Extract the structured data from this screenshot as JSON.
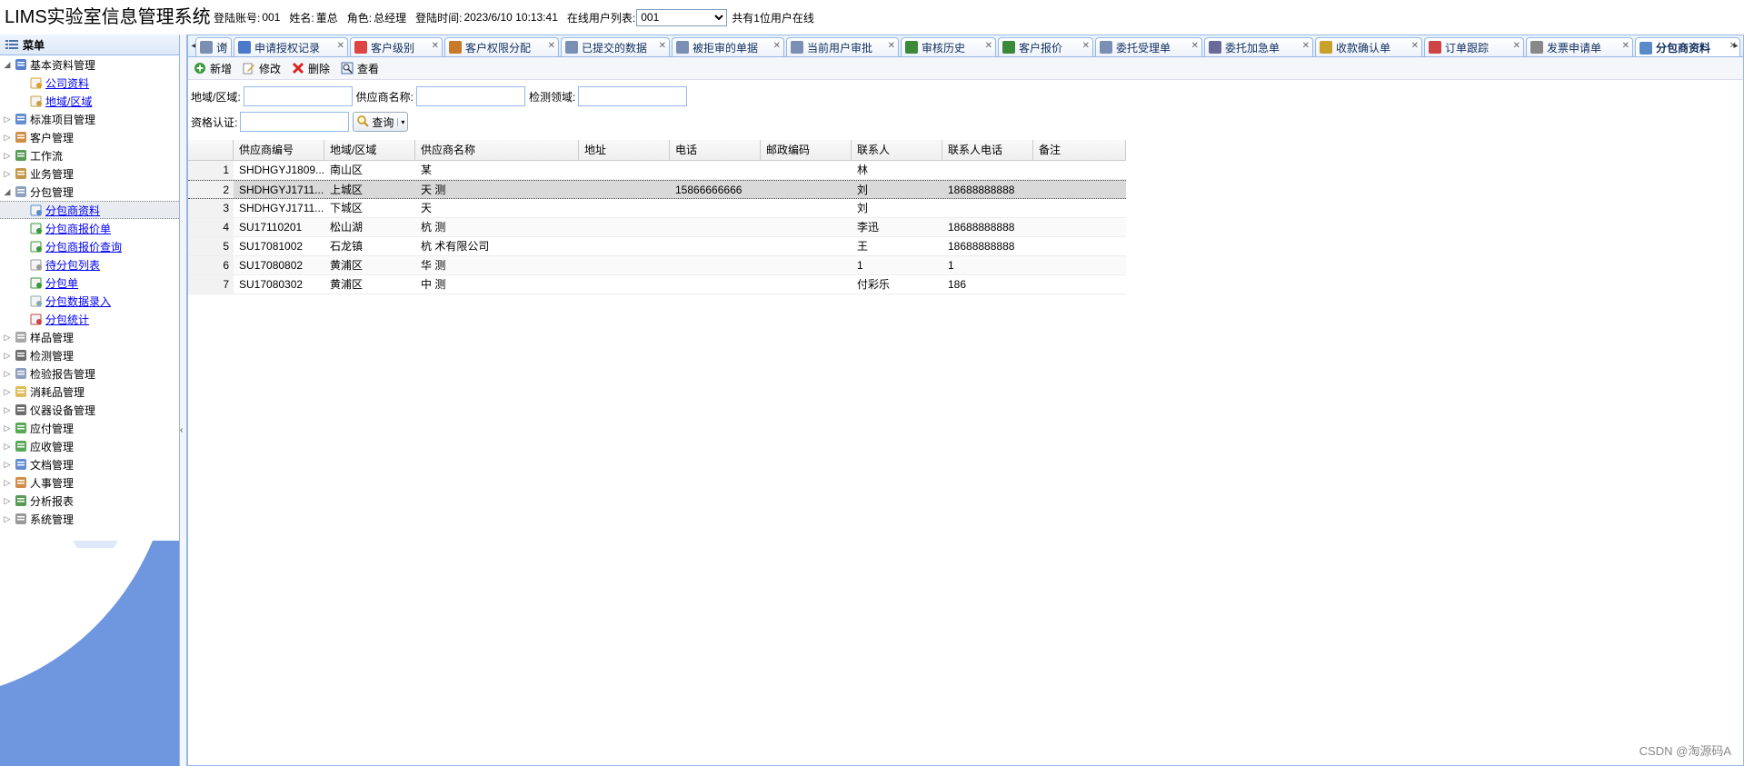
{
  "header": {
    "title": "LIMS实验室信息管理系统",
    "login_account_label": "登陆账号:",
    "login_account": "001",
    "name_label": "姓名:",
    "name": "董总",
    "role_label": "角色:",
    "role": "总经理",
    "login_time_label": "登陆时间:",
    "login_time": "2023/6/10 10:13:41",
    "online_list_label": "在线用户列表:",
    "online_selected": "001",
    "online_count_text": "共有1位用户在线"
  },
  "sidebar": {
    "title": "菜单",
    "groups": [
      {
        "label": "基本资料管理",
        "expanded": true,
        "icon": "database-icon",
        "children": [
          {
            "label": "公司资料",
            "icon": "edit-doc-icon"
          },
          {
            "label": "地域/区域",
            "icon": "map-icon"
          }
        ]
      },
      {
        "label": "标准项目管理",
        "icon": "table-icon"
      },
      {
        "label": "客户管理",
        "icon": "user-icon"
      },
      {
        "label": "工作流",
        "icon": "workflow-icon"
      },
      {
        "label": "业务管理",
        "icon": "briefcase-icon"
      },
      {
        "label": "分包管理",
        "expanded": true,
        "icon": "package-icon",
        "children": [
          {
            "label": "分包商资料",
            "icon": "vendor-icon",
            "selected": true
          },
          {
            "label": "分包商报价单",
            "icon": "quote-icon"
          },
          {
            "label": "分包商报价查询",
            "icon": "quote-search-icon"
          },
          {
            "label": "待分包列表",
            "icon": "list-icon"
          },
          {
            "label": "分包单",
            "icon": "order-icon"
          },
          {
            "label": "分包数据录入",
            "icon": "data-entry-icon"
          },
          {
            "label": "分包统计",
            "icon": "stats-icon"
          }
        ]
      },
      {
        "label": "样品管理",
        "icon": "sample-icon"
      },
      {
        "label": "检测管理",
        "icon": "monitor-icon"
      },
      {
        "label": "检验报告管理",
        "icon": "report-icon"
      },
      {
        "label": "消耗品管理",
        "icon": "box-icon"
      },
      {
        "label": "仪器设备管理",
        "icon": "device-icon"
      },
      {
        "label": "应付管理",
        "icon": "payable-icon"
      },
      {
        "label": "应收管理",
        "icon": "receivable-icon"
      },
      {
        "label": "文档管理",
        "icon": "document-icon"
      },
      {
        "label": "人事管理",
        "icon": "people-icon"
      },
      {
        "label": "分析报表",
        "icon": "chart-icon"
      },
      {
        "label": "系统管理",
        "icon": "gear-icon"
      }
    ]
  },
  "tabs": [
    {
      "label": "询",
      "color": "#7a8fb3"
    },
    {
      "label": "申请授权记录",
      "color": "#4a7ac9"
    },
    {
      "label": "客户级别",
      "color": "#d44"
    },
    {
      "label": "客户权限分配",
      "color": "#c87a2a"
    },
    {
      "label": "已提交的数据",
      "color": "#7a8fb3"
    },
    {
      "label": "被拒审的单据",
      "color": "#7a8fb3"
    },
    {
      "label": "当前用户审批",
      "color": "#7a8fb3"
    },
    {
      "label": "审核历史",
      "color": "#3a8a3a"
    },
    {
      "label": "客户报价",
      "color": "#3a8a3a"
    },
    {
      "label": "委托受理单",
      "color": "#7a8fb3"
    },
    {
      "label": "委托加急单",
      "color": "#6a6a9a"
    },
    {
      "label": "收款确认单",
      "color": "#c8a02a"
    },
    {
      "label": "订单跟踪",
      "color": "#c44"
    },
    {
      "label": "发票申请单",
      "color": "#888"
    },
    {
      "label": "分包商资料",
      "color": "#5a8ac9",
      "active": true
    }
  ],
  "toolbar": {
    "add": "新增",
    "edit": "修改",
    "delete": "删除",
    "view": "查看"
  },
  "filters": {
    "region_label": "地域/区域:",
    "region_value": "",
    "supplier_name_label": "供应商名称:",
    "supplier_name_value": "",
    "test_field_label": "检测领域:",
    "test_field_value": "",
    "qualification_label": "资格认证:",
    "qualification_value": "",
    "search_button": "查询"
  },
  "grid": {
    "columns": [
      "",
      "供应商编号",
      "地域/区域",
      "供应商名称",
      "地址",
      "电话",
      "邮政编码",
      "联系人",
      "联系人电话",
      "备注"
    ],
    "rows": [
      [
        "1",
        "SHDHGYJ1809...",
        "南山区",
        "某",
        "",
        "",
        "",
        "林",
        "",
        ""
      ],
      [
        "2",
        "SHDHGYJ1711...",
        "上城区",
        "天    测",
        "",
        "15866666666",
        "",
        "刘",
        "18688888888",
        ""
      ],
      [
        "3",
        "SHDHGYJ1711...",
        "下城区",
        "天",
        "",
        "",
        "",
        "刘",
        "",
        ""
      ],
      [
        "4",
        "SU17110201",
        "松山湖",
        "杭    测",
        "",
        "",
        "",
        "李迅",
        "18688888888",
        ""
      ],
      [
        "5",
        "SU17081002",
        "石龙镇",
        "杭    术有限公司",
        "",
        "",
        "",
        "王",
        "18688888888",
        ""
      ],
      [
        "6",
        "SU17080802",
        "黄浦区",
        "华    测",
        "",
        "",
        "",
        "1",
        "1",
        ""
      ],
      [
        "7",
        "SU17080302",
        "黄浦区",
        "中    测",
        "",
        "",
        "",
        "付彩乐",
        "186",
        ""
      ]
    ]
  },
  "watermark": "CSDN @淘源码A"
}
